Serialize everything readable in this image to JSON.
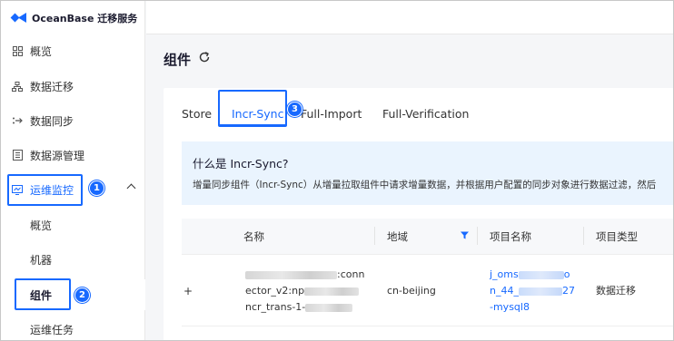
{
  "app": {
    "logo_text": "OceanBase 迁移服务"
  },
  "sidebar": {
    "items": [
      {
        "label": "概览",
        "icon": "overview-grid-icon"
      },
      {
        "label": "数据迁移",
        "icon": "migration-tree-icon"
      },
      {
        "label": "数据同步",
        "icon": "sync-icon"
      },
      {
        "label": "数据源管理",
        "icon": "datasource-icon"
      },
      {
        "label": "运维监控",
        "icon": "monitor-icon",
        "expanded": true
      },
      {
        "label": "概览"
      },
      {
        "label": "机器"
      },
      {
        "label": "组件",
        "selected": true
      },
      {
        "label": "运维任务"
      }
    ]
  },
  "annotations": {
    "badge1": "1",
    "badge2": "2",
    "badge3": "3",
    "accent_color": "#1769ff"
  },
  "page": {
    "title": "组件"
  },
  "tabs": [
    {
      "label": "Store"
    },
    {
      "label": "Incr-Sync",
      "active": true
    },
    {
      "label": "Full-Import"
    },
    {
      "label": "Full-Verification"
    }
  ],
  "info": {
    "title": "什么是 Incr-Sync?",
    "description": "增量同步组件（Incr-Sync）从增量拉取组件中请求增量数据，并根据用户配置的同步对象进行数据过滤，然后"
  },
  "table": {
    "columns": [
      "名称",
      "地域",
      "项目名称",
      "项目类型"
    ],
    "rows": [
      {
        "expand": "+",
        "name_lines": [
          ":conn",
          "ector_v2:np",
          "ncr_trans-1-"
        ],
        "region": "cn-beijing",
        "project_lines": [
          "j_oms",
          "n_44_",
          "-mysql8"
        ],
        "project_tail": [
          "o",
          "27"
        ],
        "project_type": "数据迁移"
      }
    ]
  }
}
